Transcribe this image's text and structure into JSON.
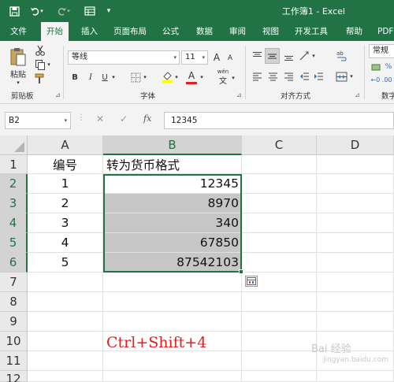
{
  "window": {
    "title": "工作簿1  -  Excel"
  },
  "quick_access": {
    "save_icon": "save-icon",
    "undo_icon": "undo-icon",
    "redo_icon": "redo-icon",
    "form_icon": "form-icon",
    "customize_icon": "customize-icon"
  },
  "tabs": [
    {
      "label": "文件"
    },
    {
      "label": "开始"
    },
    {
      "label": "插入"
    },
    {
      "label": "页面布局"
    },
    {
      "label": "公式"
    },
    {
      "label": "数据"
    },
    {
      "label": "审阅"
    },
    {
      "label": "视图"
    },
    {
      "label": "开发工具"
    },
    {
      "label": "帮助"
    },
    {
      "label": "PDF"
    }
  ],
  "ribbon": {
    "clipboard": {
      "paste_label": "粘贴",
      "group_label": "剪贴板"
    },
    "font": {
      "font_name": "等线",
      "font_size": "11",
      "group_label": "字体",
      "bold": "B",
      "italic": "I",
      "underline": "U",
      "grow": "A",
      "shrink": "A",
      "color_a": "A",
      "wen": "wén",
      "wen_char": "文"
    },
    "alignment": {
      "group_label": "对齐方式"
    },
    "number": {
      "format": "常规",
      "group_label": "数字"
    }
  },
  "formula_bar": {
    "name_box": "B2",
    "fx": "fx",
    "value": "12345"
  },
  "sheet": {
    "columns": [
      "A",
      "B",
      "C",
      "D"
    ],
    "rows": [
      "1",
      "2",
      "3",
      "4",
      "5",
      "6",
      "7",
      "8",
      "9",
      "10",
      "11",
      "12"
    ],
    "header_a": "编号",
    "header_b": "转为货币格式",
    "data": [
      {
        "a": "1",
        "b": "12345"
      },
      {
        "a": "2",
        "b": "8970"
      },
      {
        "a": "3",
        "b": "340"
      },
      {
        "a": "4",
        "b": "67850"
      },
      {
        "a": "5",
        "b": "87542103"
      }
    ]
  },
  "annotation": "Ctrl+Shift+4",
  "watermark": "Bai 经验",
  "watermark_sub": "jingyan.baidu.com",
  "colors": {
    "excel_green": "#217346",
    "selection_shade": "#c6c6c6",
    "annotation_red": "#e02020"
  }
}
